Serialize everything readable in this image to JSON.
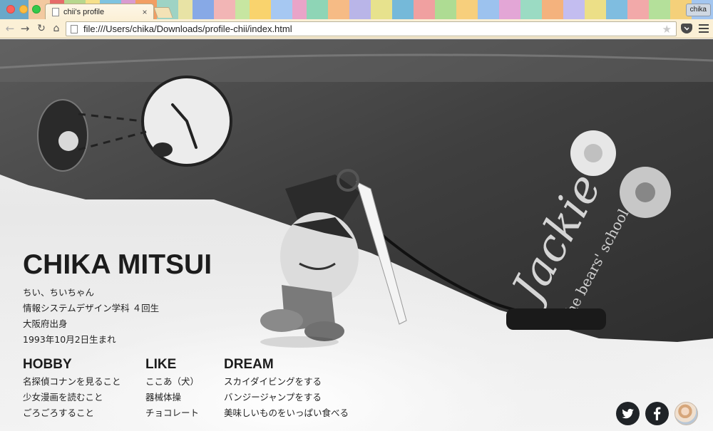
{
  "browser": {
    "tab_title": "chii's profile",
    "tab_close": "×",
    "user_badge": "chika",
    "url": "file:///Users/chika/Downloads/profile-chii/index.html",
    "nav": {
      "back": "←",
      "forward": "→",
      "reload": "↻",
      "home": "⌂"
    },
    "star": "★"
  },
  "profile": {
    "name": "CHIKA MITSUI",
    "bio": [
      "ちい、ちいちゃん",
      "情報システムデザイン学科 ４回生",
      "大阪府出身",
      "1993年10月2日生まれ"
    ],
    "sections": [
      {
        "title": "HOBBY",
        "items": [
          "名探偵コナンを見ること",
          "少女漫画を読むこと",
          "ごろごろすること"
        ]
      },
      {
        "title": "LIKE",
        "items": [
          "ここあ（犬）",
          "器械体操",
          "チョコレート"
        ]
      },
      {
        "title": "DREAM",
        "items": [
          "スカイダイビングをする",
          "バンジージャンプをする",
          "美味しいものをいっぱい食べる"
        ]
      }
    ]
  },
  "social": {
    "icons": [
      "twitter-icon",
      "facebook-icon",
      "avatar"
    ],
    "colors": {
      "icon_bg": "#1f2327",
      "icon_fg": "#ffffff"
    }
  },
  "photo": {
    "case_text": "Jackie",
    "case_subtext": "the bears' school"
  }
}
